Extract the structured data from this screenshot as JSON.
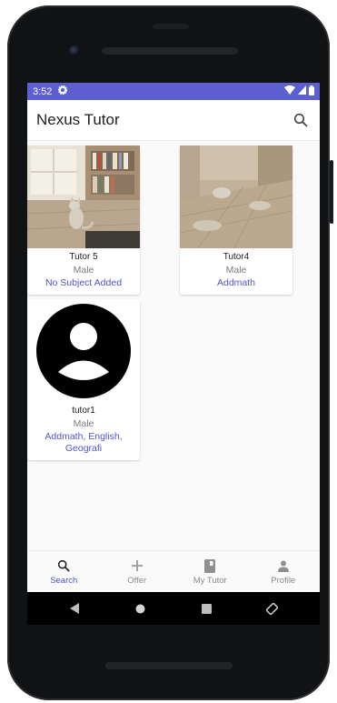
{
  "status": {
    "time": "3:52"
  },
  "app": {
    "title": "Nexus Tutor"
  },
  "tutors": [
    {
      "name": "Tutor 5",
      "gender": "Male",
      "subject": "No Subject Added",
      "photo": "cat-room-photo"
    },
    {
      "name": "Tutor4",
      "gender": "Male",
      "subject": "Addmath",
      "photo": "floor-room-photo"
    },
    {
      "name": "tutor1",
      "gender": "Male",
      "subject": "Addmath, English, Geografi",
      "photo": "default-avatar"
    }
  ],
  "nav": {
    "items": [
      {
        "label": "Search",
        "icon": "search-icon",
        "active": true
      },
      {
        "label": "Offer",
        "icon": "plus-icon",
        "active": false
      },
      {
        "label": "My Tutor",
        "icon": "book-icon",
        "active": false
      },
      {
        "label": "Profile",
        "icon": "person-icon",
        "active": false
      }
    ]
  },
  "colors": {
    "status_bar": "#5c5fcf",
    "accent": "#4f55c9",
    "background": "#fafafa"
  }
}
